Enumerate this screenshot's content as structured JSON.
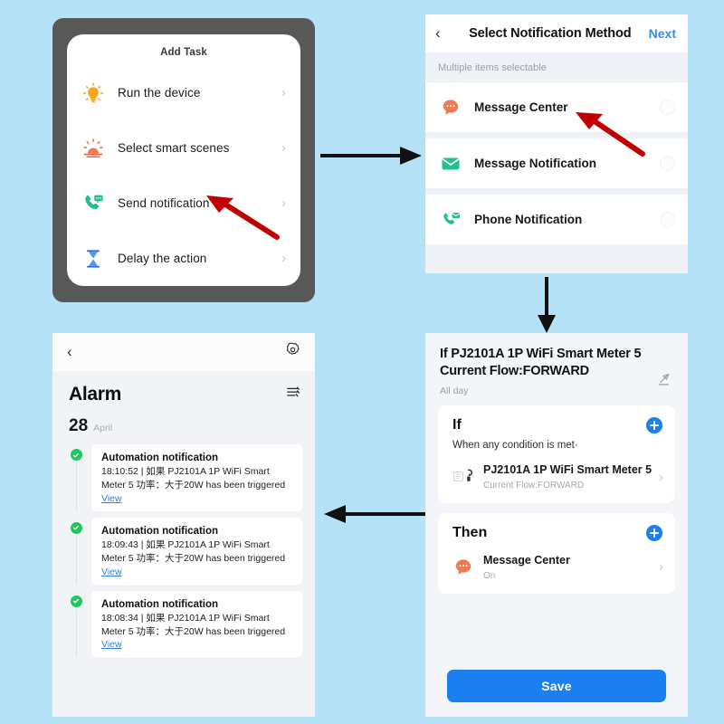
{
  "background_color": "#b5e2f7",
  "accent_blue": "#1b7ff0",
  "panel_add_task": {
    "title": "Add Task",
    "items": [
      {
        "label": "Run the device",
        "icon": "lightbulb-icon",
        "chevron": "›"
      },
      {
        "label": "Select smart scenes",
        "icon": "sunrise-scene-icon",
        "chevron": "›"
      },
      {
        "label": "Send notification",
        "icon": "phone-message-icon",
        "chevron": "›"
      },
      {
        "label": "Delay the action",
        "icon": "hourglass-icon",
        "chevron": "›"
      }
    ]
  },
  "panel_notify": {
    "back_glyph": "‹",
    "title": "Select Notification Method",
    "next_label": "Next",
    "subtitle": "Multiple items selectable",
    "items": [
      {
        "label": "Message Center",
        "icon": "speech-bubble-icon",
        "selected": false
      },
      {
        "label": "Message Notification",
        "icon": "envelope-icon",
        "selected": false
      },
      {
        "label": "Phone Notification",
        "icon": "phone-envelope-icon",
        "selected": false
      }
    ]
  },
  "panel_rule": {
    "title": "If PJ2101A 1P WiFi Smart Meter  5 Current Flow:FORWARD",
    "schedule": "All day",
    "edit_icon": "pencil-icon",
    "if_section": {
      "heading": "If",
      "condition_mode": "When any condition is met·",
      "entry_name": "PJ2101A 1P WiFi Smart Meter 5",
      "entry_sub": "Current Flow:FORWARD",
      "entry_icon": "smart-meter-icon",
      "chevron": "›",
      "add_icon": "plus-icon"
    },
    "then_section": {
      "heading": "Then",
      "entry_name": "Message Center",
      "entry_sub": "On",
      "entry_icon": "speech-bubble-icon",
      "chevron": "›",
      "add_icon": "plus-icon"
    },
    "save_label": "Save"
  },
  "panel_alarm": {
    "back_glyph": "‹",
    "settings_icon": "gear-icon",
    "title": "Alarm",
    "filter_icon": "list-filter-icon",
    "date_day": "28",
    "date_month": "April",
    "notifications": [
      {
        "title": "Automation notification",
        "body": "18:10:52 | 如果 PJ2101A 1P WiFi Smart Meter  5 功率：大于20W has been triggered",
        "link": "View",
        "status_icon": "check-circle-icon"
      },
      {
        "title": "Automation notification",
        "body": "18:09:43 | 如果 PJ2101A 1P WiFi Smart Meter  5 功率：大于20W has been triggered",
        "link": "View",
        "status_icon": "check-circle-icon"
      },
      {
        "title": "Automation notification",
        "body": "18:08:34 | 如果 PJ2101A 1P WiFi Smart Meter  5 功率：大于20W has been triggered",
        "link": "View",
        "status_icon": "check-circle-icon"
      }
    ]
  },
  "flow_arrows": [
    {
      "name": "arrow-add-task-to-notify",
      "direction": "right"
    },
    {
      "name": "arrow-notify-to-rule",
      "direction": "down"
    },
    {
      "name": "arrow-rule-to-alarm",
      "direction": "left"
    }
  ],
  "callout_arrows": [
    {
      "name": "red-pointer-send-notification",
      "color": "#c00000"
    },
    {
      "name": "red-pointer-message-center",
      "color": "#c00000"
    }
  ]
}
